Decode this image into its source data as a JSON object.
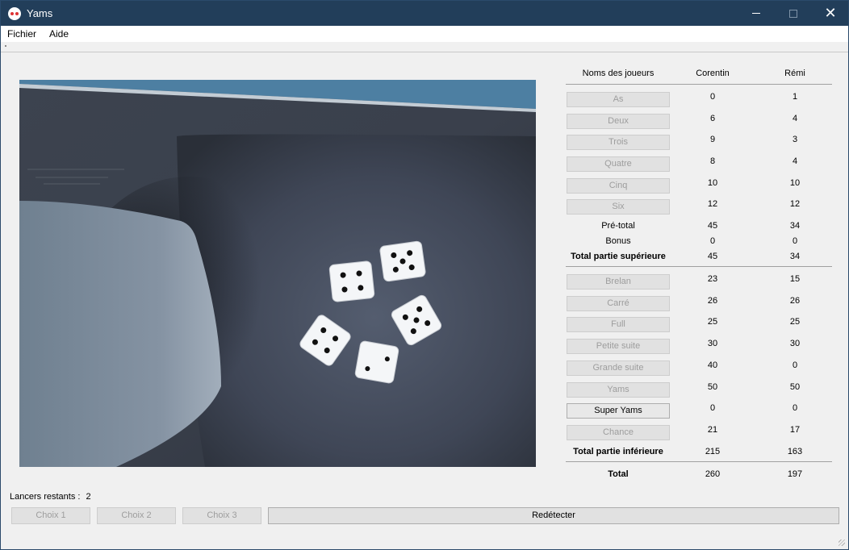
{
  "window": {
    "title": "Yams",
    "minimize_icon": "minimize-icon",
    "maximize_icon": "maximize-icon",
    "close_icon": "close-icon",
    "close_glyph": "✕"
  },
  "menu": {
    "items": [
      "Fichier",
      "Aide"
    ]
  },
  "scoreboard": {
    "header": {
      "names_label": "Noms des joueurs",
      "player1": "Corentin",
      "player2": "Rémi"
    },
    "upper": [
      {
        "label": "As",
        "p1": "0",
        "p2": "1"
      },
      {
        "label": "Deux",
        "p1": "6",
        "p2": "4"
      },
      {
        "label": "Trois",
        "p1": "9",
        "p2": "3"
      },
      {
        "label": "Quatre",
        "p1": "8",
        "p2": "4"
      },
      {
        "label": "Cinq",
        "p1": "10",
        "p2": "10"
      },
      {
        "label": "Six",
        "p1": "12",
        "p2": "12"
      }
    ],
    "pretotal": {
      "label": "Pré-total",
      "p1": "45",
      "p2": "34"
    },
    "bonus": {
      "label": "Bonus",
      "p1": "0",
      "p2": "0"
    },
    "upper_total": {
      "label": "Total partie supérieure",
      "p1": "45",
      "p2": "34"
    },
    "lower": [
      {
        "label": "Brelan",
        "p1": "23",
        "p2": "15"
      },
      {
        "label": "Carré",
        "p1": "26",
        "p2": "26"
      },
      {
        "label": "Full",
        "p1": "25",
        "p2": "25"
      },
      {
        "label": "Petite suite",
        "p1": "30",
        "p2": "30"
      },
      {
        "label": "Grande suite",
        "p1": "40",
        "p2": "0"
      },
      {
        "label": "Yams",
        "p1": "50",
        "p2": "50"
      },
      {
        "label": "Super Yams",
        "p1": "0",
        "p2": "0"
      },
      {
        "label": "Chance",
        "p1": "21",
        "p2": "17"
      }
    ],
    "lower_total": {
      "label": "Total partie inférieure",
      "p1": "215",
      "p2": "163"
    },
    "total": {
      "label": "Total",
      "p1": "260",
      "p2": "197"
    }
  },
  "footer": {
    "remaining_label": "Lancers restants :",
    "remaining_value": "2",
    "choice1": "Choix 1",
    "choice2": "Choix 2",
    "choice3": "Choix 3",
    "redetect": "Redétecter"
  },
  "camera": {
    "dice_values": [
      4,
      5,
      5,
      4,
      2
    ]
  }
}
